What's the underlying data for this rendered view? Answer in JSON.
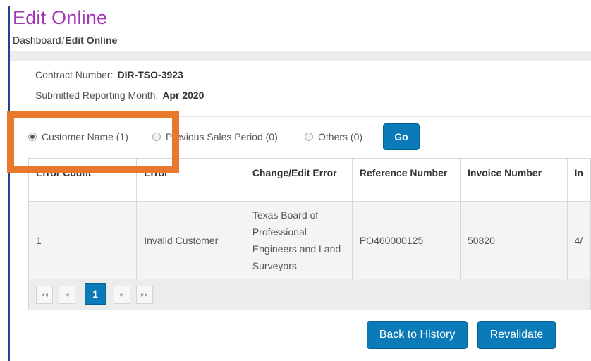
{
  "header": {
    "title": "Edit Online",
    "breadcrumb": {
      "link": "Dashboard",
      "separator": "/",
      "current": "Edit Online"
    }
  },
  "info": {
    "contract_label": "Contract Number:",
    "contract_value": "DIR-TSO-3923",
    "month_label": "Submitted Reporting Month:",
    "month_value": "Apr 2020"
  },
  "filters": {
    "options": [
      {
        "label": "Customer Name (1)",
        "checked": true
      },
      {
        "label": "Previous Sales Period (0)",
        "checked": false
      },
      {
        "label": "Others (0)",
        "checked": false
      }
    ],
    "go_label": "Go"
  },
  "table": {
    "columns": [
      "Error Count",
      "Error",
      "Change/Edit Error",
      "Reference Number",
      "Invoice Number",
      "In"
    ],
    "rows": [
      [
        "1",
        "Invalid Customer",
        "Texas Board of Professional Engineers and Land Surveyors",
        "PO460000125",
        "50820",
        "4/"
      ]
    ]
  },
  "pager": {
    "first": "◂◂",
    "prev": "◂",
    "current_page": "1",
    "next": "▸",
    "last": "▸▸"
  },
  "actions": {
    "history_label": "Back to History",
    "revalidate_label": "Revalidate"
  },
  "colors": {
    "title": "#a336b8",
    "primary_button": "#0a7ab8",
    "highlight_box": "#e8792c"
  }
}
